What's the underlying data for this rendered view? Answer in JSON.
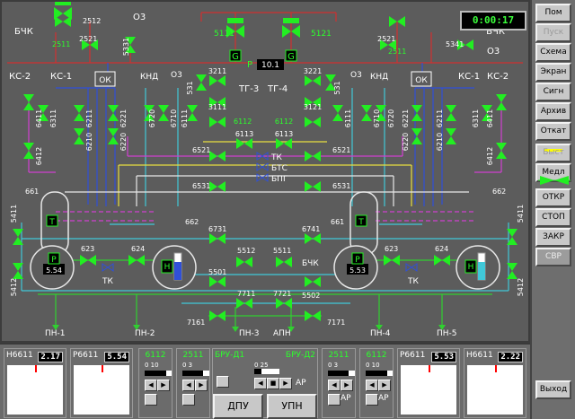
{
  "clock": "0:00:17",
  "sidebar": {
    "buttons": [
      "Пом",
      "Пуск",
      "Схема",
      "Экран",
      "Сигн",
      "Архив",
      "Откат",
      "Быст",
      "Медл",
      "ОТКР",
      "СТОП",
      "ЗАКР",
      "СВР",
      "Выход"
    ]
  },
  "scheme": {
    "top_tags": {
      "l_bck": "БЧК",
      "r_bck": "БЧК",
      "l_o3": "О3",
      "r_o3": "О3",
      "v2512": "2512",
      "v2511": "2511",
      "v2521l": "2521",
      "v5331": "5331",
      "v5111": "5111",
      "v5121": "5121",
      "v2511r": "2511",
      "v2521r": "2521",
      "v5341": "5341",
      "g1": "G",
      "g2": "G",
      "p": "P",
      "p_val": "10.1"
    },
    "mid_tags": {
      "ok_l": "ОК",
      "ok_r": "ОК",
      "ks2_l": "КС-2",
      "ks1_l": "КС-1",
      "ks1_r": "КС-1",
      "ks2_r": "КС-2",
      "knd_l": "КНД",
      "knd_r": "КНД",
      "o3_ml": "О3",
      "o3_mr": "О3",
      "tg3": "ТГ-3",
      "tg4": "ТГ-4"
    },
    "valves": {
      "v531l": "531",
      "v3211": "3211",
      "v3111": "3111",
      "v3221": "3221",
      "v3121": "3121",
      "v531r": "531",
      "v6411l": "6411",
      "v6311l": "6311",
      "v6211l": "6211",
      "v6221l": "6221",
      "v6720l": "6720",
      "v6710l": "6710",
      "v6111l": "6111",
      "v6210l": "6210",
      "v6220l": "6220",
      "v6112l": "6112",
      "v6112r": "6112",
      "v6111r": "6111",
      "v6710r": "6710",
      "v6720r": "6720",
      "v6221r": "6221",
      "v6211r": "6211",
      "v6311r": "6311",
      "v6411r": "6411",
      "v6210r": "6210",
      "v6220r": "6220",
      "v6412l": "6412",
      "v6412r": "6412",
      "v6113l": "6113",
      "v6113r": "6113",
      "v6521l": "6521",
      "v6521r": "6521",
      "v6531l": "6531",
      "v6531r": "6531",
      "tk": "ТК",
      "btc": "БТС",
      "bpg": "БПГ",
      "v661l": "661",
      "v662l": "662",
      "v661r": "661",
      "v662r": "662",
      "v5411l": "5411",
      "v5412l": "5412",
      "v5411r": "5411",
      "v5412r": "5412",
      "v6731": "6731",
      "v6741": "6741",
      "v623l": "623",
      "v624l": "624",
      "v623r": "623",
      "v624r": "624",
      "tk_l": "ТК",
      "tk_r": "ТК",
      "v5512": "5512",
      "v5511": "5511",
      "bck_c": "БЧК",
      "v5501": "5501",
      "v5502": "5502",
      "v7711": "7711",
      "v7721": "7721",
      "v7161": "7161",
      "v7171": "7171"
    },
    "tank_tags": {
      "t": "Т",
      "p": "P",
      "h": "H",
      "pl": "5.54",
      "pr": "5.53"
    },
    "pumps": {
      "pn1": "ПН-1",
      "pn2": "ПН-2",
      "pn3": "ПН-3",
      "apn": "АПН",
      "pn4": "ПН-4",
      "pn5": "ПН-5"
    }
  },
  "bottom": {
    "gauges": [
      {
        "label": "H6611",
        "value": "2.17"
      },
      {
        "label": "P6611",
        "value": "5.54"
      },
      {
        "label": "P6611",
        "value": "5.53"
      },
      {
        "label": "H6611",
        "value": "2.22"
      }
    ],
    "valves": [
      {
        "title": "6112",
        "scale": "0   10",
        "fill": 0.8,
        "ar": ""
      },
      {
        "title": "2511",
        "scale": "0   3",
        "fill": 0.75,
        "ar": ""
      },
      {
        "title": "2511",
        "scale": "0   3",
        "fill": 0.75,
        "ar": "AP"
      },
      {
        "title": "6112",
        "scale": "0   10",
        "fill": 0.8,
        "ar": "AP"
      }
    ],
    "brd1": "БРУ-Д1",
    "brd2": "БРУ-Д2",
    "brd_scale": "0    25",
    "brd_fill": 0.3,
    "brd_ar": "AP",
    "btn_dpu": "ДПУ",
    "btn_upn": "УПН",
    "arrows": {
      "l": "◀",
      "r": "▶",
      "s": "■"
    }
  },
  "colors": {
    "valve": "#22ee22",
    "valve_dark": "#0a7a0a",
    "pipe_red": "#d03030",
    "pipe_blue": "#3050d8",
    "pipe_cyan": "#40c8d8",
    "pipe_magenta": "#d040d0",
    "pipe_yellow": "#e8e040",
    "pipe_white": "#e8e8e8",
    "pipe_green": "#30d030"
  }
}
